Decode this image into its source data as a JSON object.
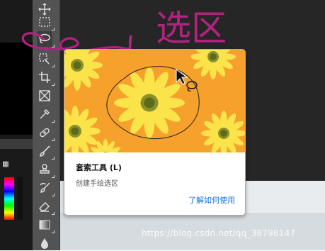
{
  "annotation": {
    "text": "选区"
  },
  "tooltip": {
    "title": "套索工具 (L)",
    "description": "创建手绘选区",
    "link": "了解如何使用"
  },
  "watermark": "https://blog.csdn.net/qq_38798147",
  "toolbar": {
    "tools": [
      "move-tool",
      "rectangular-marquee-tool",
      "lasso-tool",
      "quick-selection-tool",
      "crop-tool",
      "frame-tool",
      "eyedropper-tool",
      "healing-brush-tool",
      "brush-tool",
      "clone-stamp-tool",
      "history-brush-tool",
      "eraser-tool",
      "gradient-tool",
      "blur-tool"
    ],
    "active_tool": "lasso-tool"
  },
  "colors": {
    "annotation": "#b2237f",
    "link": "#1473e6",
    "preview_bg": "#f6a12b",
    "toolbar_bg": "#535353"
  }
}
